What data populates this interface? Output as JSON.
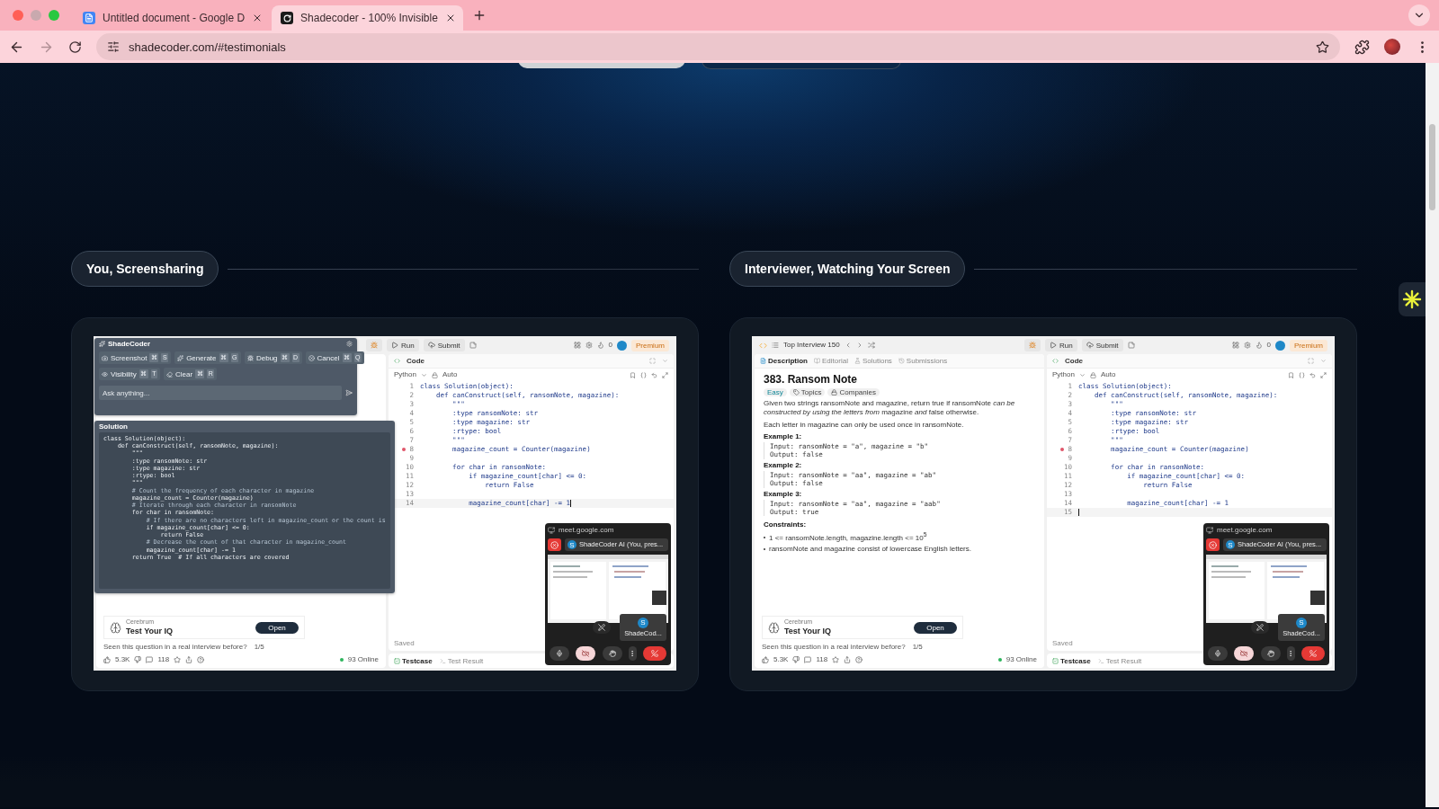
{
  "browser": {
    "tabs": [
      {
        "title": "Untitled document - Google D",
        "selected": false
      },
      {
        "title": "Shadecoder - 100% Invisible",
        "selected": true
      }
    ],
    "forward_disabled": true,
    "url": "shadecoder.com/#testimonials"
  },
  "sections": [
    {
      "heading": "You, Screensharing",
      "screen": {
        "toolbar": {
          "run": "Run",
          "submit": "Submit",
          "streak": "0",
          "premium": "Premium"
        },
        "overlay": {
          "title": "ShadeCoder",
          "action_rows": [
            [
              {
                "label": "Screenshot",
                "keys": [
                  "⌘",
                  "S"
                ]
              },
              {
                "label": "Generate",
                "keys": [
                  "⌘",
                  "G"
                ]
              },
              {
                "label": "Debug",
                "keys": [
                  "⌘",
                  "D"
                ]
              },
              {
                "label": "Cancel",
                "keys": [
                  "⌘",
                  "Q"
                ]
              }
            ],
            [
              {
                "label": "Visibility",
                "keys": [
                  "⌘",
                  "T"
                ]
              },
              {
                "label": "Clear",
                "keys": [
                  "⌘",
                  "R"
                ]
              }
            ]
          ],
          "ask_placeholder": "Ask anything...",
          "solution_title": "Solution",
          "solution_code": [
            "class Solution(object):",
            "    def canConstruct(self, ransomNote, magazine):",
            "        \"\"\"",
            "        :type ransomNote: str",
            "        :type magazine: str",
            "        :rtype: bool",
            "        \"\"\"",
            "        # Count the frequency of each character in magazine",
            "        magazine_count = Counter(magazine)",
            "        # Iterate through each character in ransomNote",
            "        for char in ransomNote:",
            "            # If there are no characters left in magazine_count or the count is",
            "            if magazine_count[char] <= 0:",
            "                return False",
            "            # Decrease the count of that character in magazine_count",
            "            magazine_count[char] -= 1",
            "        return True  # If all characters are covered"
          ]
        },
        "ad": {
          "brand": "Cerebrum",
          "title": "Test Your IQ",
          "button": "Open"
        },
        "seen": "Seen this question in a real interview before?",
        "seen_count": "1/5",
        "likes": "5.3K",
        "comments": "118",
        "online": "93 Online",
        "code_title": "Code",
        "language": "Python",
        "mode": "Auto",
        "code": [
          {
            "n": "1",
            "text": "class Solution(object):",
            "breakpoint": false,
            "cursor": false
          },
          {
            "n": "2",
            "text": "    def canConstruct(self, ransomNote, magazine):",
            "breakpoint": false,
            "cursor": false
          },
          {
            "n": "3",
            "text": "        \"\"\"",
            "breakpoint": false,
            "cursor": false
          },
          {
            "n": "4",
            "text": "        :type ransomNote: str",
            "breakpoint": false,
            "cursor": false
          },
          {
            "n": "5",
            "text": "        :type magazine: str",
            "breakpoint": false,
            "cursor": false
          },
          {
            "n": "6",
            "text": "        :rtype: bool",
            "breakpoint": false,
            "cursor": false
          },
          {
            "n": "7",
            "text": "        \"\"\"",
            "breakpoint": false,
            "cursor": false
          },
          {
            "n": "8",
            "text": "        magazine_count = Counter(magazine)",
            "breakpoint": true,
            "cursor": false
          },
          {
            "n": "9",
            "breakpoint": false,
            "cursor": false
          },
          {
            "n": "10",
            "text": "        for char in ransomNote:",
            "breakpoint": false,
            "cursor": false
          },
          {
            "n": "11",
            "text": "            if magazine_count[char] <= 0:",
            "breakpoint": false,
            "cursor": false
          },
          {
            "n": "12",
            "text": "                return False",
            "breakpoint": false,
            "cursor": false
          },
          {
            "n": "13",
            "breakpoint": false,
            "cursor": false
          },
          {
            "n": "14",
            "text": "            magazine_count[char] -= 1",
            "breakpoint": false,
            "cursor": true
          }
        ],
        "saved": "Saved",
        "bottom_tabs": [
          {
            "label": "Testcase",
            "selected": true
          },
          {
            "label": "Test Result",
            "selected": false
          }
        ],
        "meet": {
          "url": "meet.google.com",
          "avatar_letter": "S",
          "presenter": "ShadeCoder AI (You, pres...",
          "tile_letter": "S",
          "tile_label": "ShadeCod..."
        }
      }
    },
    {
      "heading": "Interviewer, Watching Your Screen",
      "screen": {
        "toolbar": {
          "problem_list": "Top Interview 150",
          "run": "Run",
          "submit": "Submit",
          "streak": "0",
          "premium": "Premium"
        },
        "description_tabs": [
          {
            "label": "Description",
            "selected": true
          },
          {
            "label": "Editorial",
            "selected": false
          },
          {
            "label": "Solutions",
            "selected": false
          },
          {
            "label": "Submissions",
            "selected": false
          }
        ],
        "title": "383. Ransom Note",
        "tags": [
          "Easy",
          "Topics",
          "Companies"
        ],
        "paragraphs": [
          "Given two strings ransomNote and magazine, return true if ransomNote *can be constructed by using the letters from* magazine *and* false otherwise.",
          "Each letter in magazine can only be used once in ransomNote."
        ],
        "examples": [
          {
            "heading": "Example 1:",
            "input": "Input: ransomNote = \"a\", magazine = \"b\"",
            "output": "Output: false"
          },
          {
            "heading": "Example 2:",
            "input": "Input: ransomNote = \"aa\", magazine = \"ab\"",
            "output": "Output: false"
          },
          {
            "heading": "Example 3:",
            "input": "Input: ransomNote = \"aa\", magazine = \"aab\"",
            "output": "Output: true"
          }
        ],
        "constraints_heading": "Constraints:",
        "constraints": [
          "1 <= ransomNote.length, magazine.length <= 10$^{5}$",
          "ransomNote and magazine consist of lowercase English letters."
        ],
        "ad": {
          "brand": "Cerebrum",
          "title": "Test Your IQ",
          "button": "Open"
        },
        "seen": "Seen this question in a real interview before?",
        "seen_count": "1/5",
        "likes": "5.3K",
        "comments": "118",
        "online": "93 Online",
        "code_title": "Code",
        "language": "Python",
        "mode": "Auto",
        "code": [
          {
            "n": "1",
            "text": "class Solution(object):",
            "breakpoint": false,
            "cursor": false
          },
          {
            "n": "2",
            "text": "    def canConstruct(self, ransomNote, magazine):",
            "breakpoint": false,
            "cursor": false
          },
          {
            "n": "3",
            "text": "        \"\"\"",
            "breakpoint": false,
            "cursor": false
          },
          {
            "n": "4",
            "text": "        :type ransomNote: str",
            "breakpoint": false,
            "cursor": false
          },
          {
            "n": "5",
            "text": "        :type magazine: str",
            "breakpoint": false,
            "cursor": false
          },
          {
            "n": "6",
            "text": "        :rtype: bool",
            "breakpoint": false,
            "cursor": false
          },
          {
            "n": "7",
            "text": "        \"\"\"",
            "breakpoint": false,
            "cursor": false
          },
          {
            "n": "8",
            "text": "        magazine_count = Counter(magazine)",
            "breakpoint": true,
            "cursor": false
          },
          {
            "n": "9",
            "breakpoint": false,
            "cursor": false
          },
          {
            "n": "10",
            "text": "        for char in ransomNote:",
            "breakpoint": false,
            "cursor": false
          },
          {
            "n": "11",
            "text": "            if magazine_count[char] <= 0:",
            "breakpoint": false,
            "cursor": false
          },
          {
            "n": "12",
            "text": "                return False",
            "breakpoint": false,
            "cursor": false
          },
          {
            "n": "13",
            "breakpoint": false,
            "cursor": false
          },
          {
            "n": "14",
            "text": "            magazine_count[char] -= 1",
            "breakpoint": false,
            "cursor": false
          },
          {
            "n": "15",
            "breakpoint": false,
            "cursor": true
          }
        ],
        "saved": "Saved",
        "bottom_tabs": [
          {
            "label": "Testcase",
            "selected": true
          },
          {
            "label": "Test Result",
            "selected": false
          }
        ],
        "meet": {
          "url": "meet.google.com",
          "avatar_letter": "S",
          "presenter": "ShadeCoder AI (You, pres...",
          "tile_letter": "S",
          "tile_label": "ShadeCod..."
        }
      }
    }
  ]
}
